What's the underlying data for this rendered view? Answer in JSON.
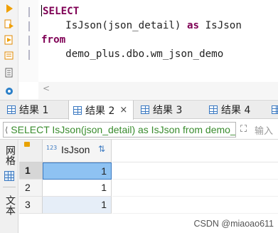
{
  "editor": {
    "lines": [
      {
        "keyword": "SELECT",
        "rest": ""
      },
      {
        "keyword": "",
        "rest": "    IsJson(json_detail) ",
        "kw2": "as",
        "rest2": " IsJson"
      },
      {
        "keyword": "from",
        "rest": ""
      },
      {
        "keyword": "",
        "rest": "    demo_plus.dbo.wm_json_demo"
      }
    ],
    "scroll_left_glyph": "<"
  },
  "colors": {
    "keyword": "#7f0055",
    "filter_text": "#3a8c2e",
    "selection": "#8ec2f2",
    "accent": "#3b79c1"
  },
  "result_tabs": [
    {
      "label": "结果 1",
      "active": false
    },
    {
      "label": "结果 2",
      "active": true,
      "close": "×"
    },
    {
      "label": "结果 3",
      "active": false
    },
    {
      "label": "结果 4",
      "active": false
    }
  ],
  "filter": {
    "value": "SELECT IsJson(json_detail) as IsJson from demo_plus.dbo.wm_json_demo",
    "icon": "filter-icon",
    "expand_glyph": "⛶",
    "hint": "输入"
  },
  "side_tabs": {
    "grid_label": "网格",
    "text_label": "文本"
  },
  "grid": {
    "column": {
      "type_badge": "123",
      "name": "IsJson",
      "sort_glyph": "⇅"
    },
    "rows": [
      {
        "num": "1",
        "value": "1"
      },
      {
        "num": "2",
        "value": "1"
      },
      {
        "num": "3",
        "value": "1"
      }
    ]
  },
  "watermark": "CSDN @miaoao611"
}
